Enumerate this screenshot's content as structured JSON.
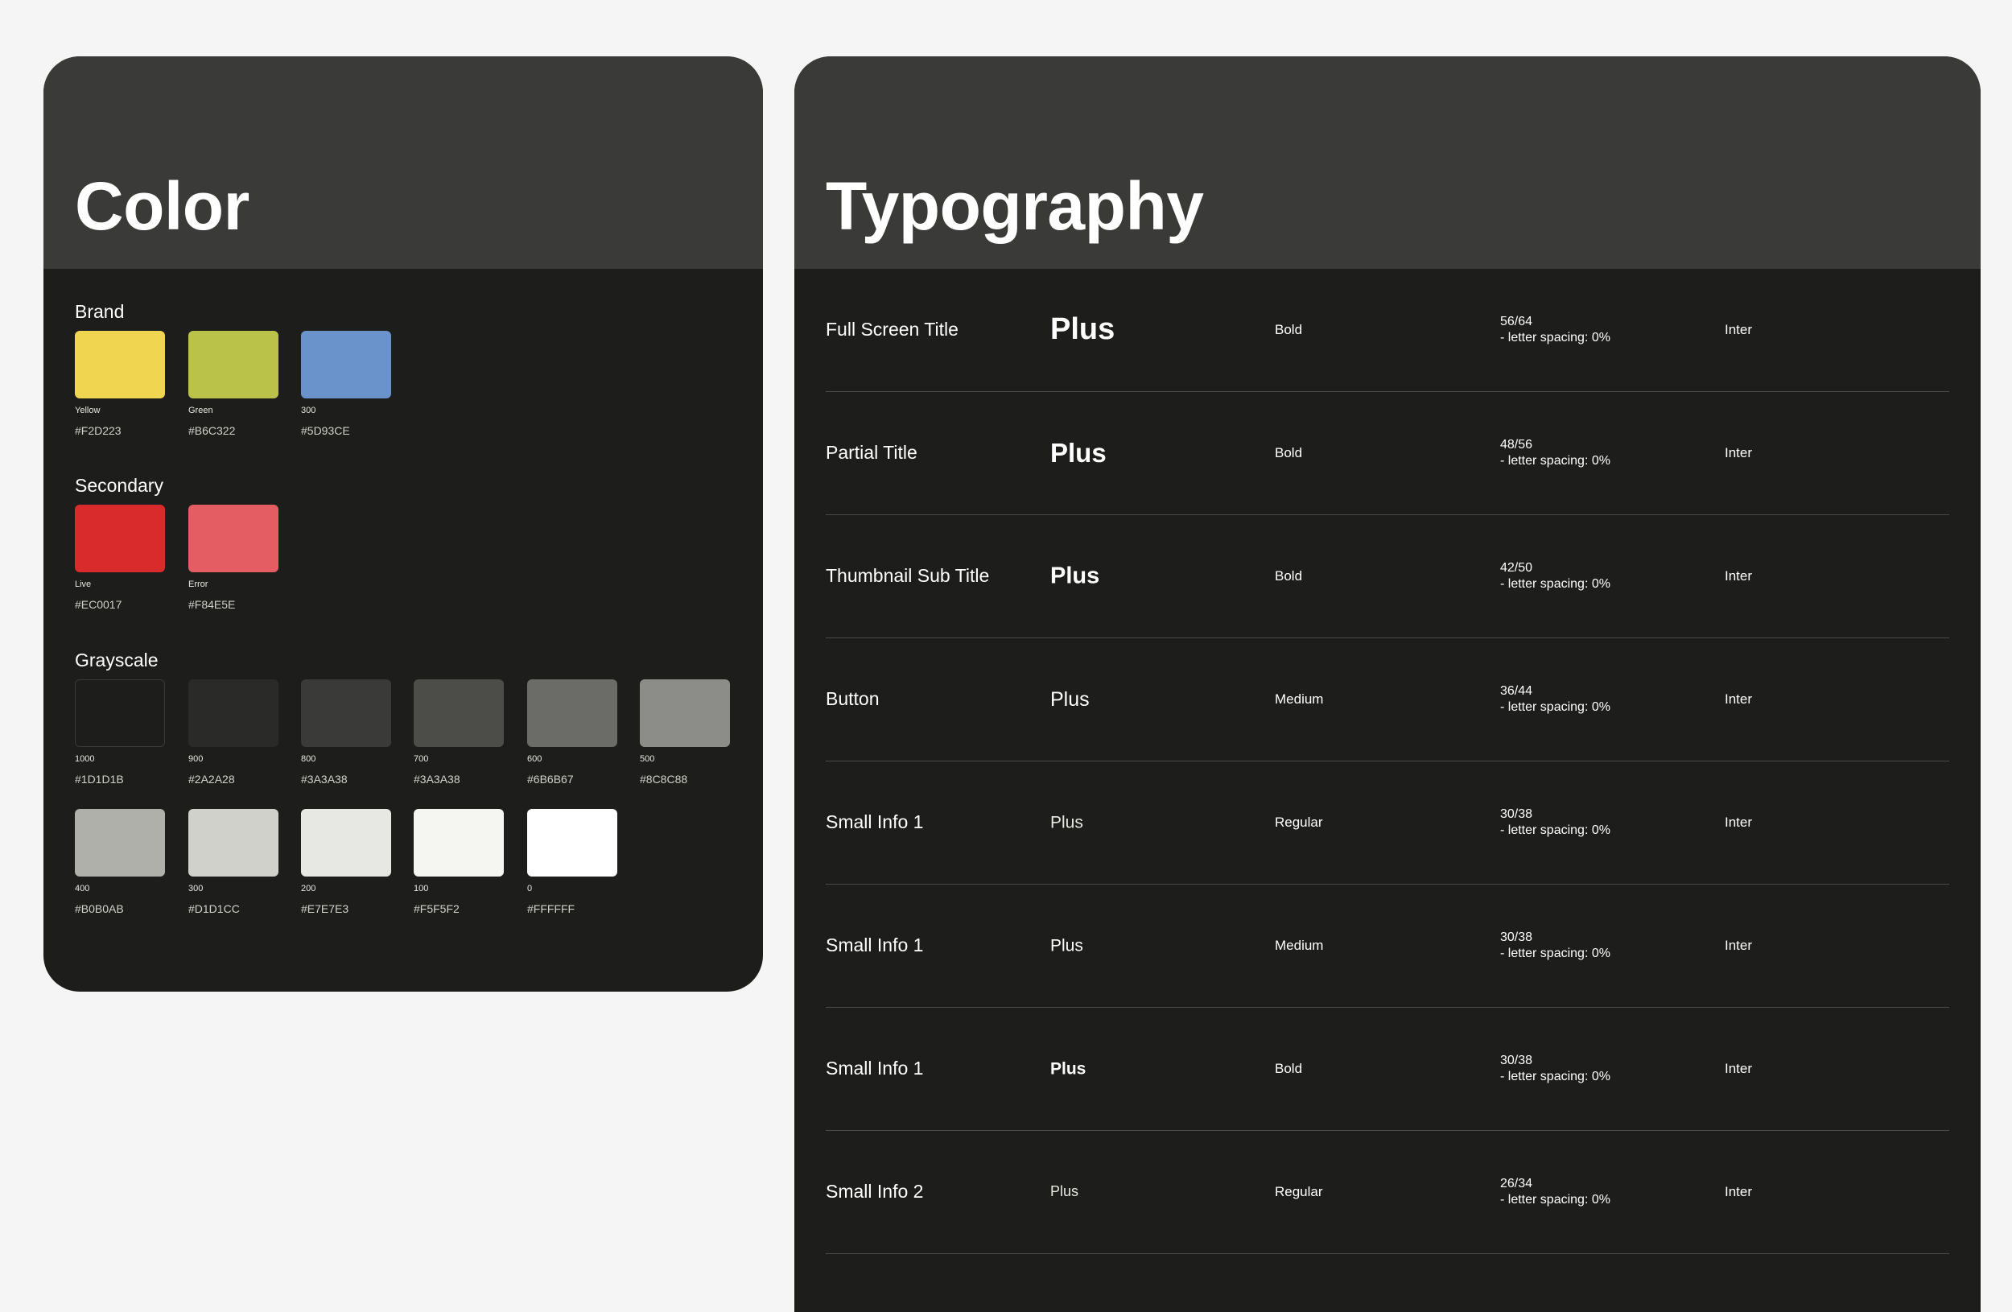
{
  "color_panel": {
    "title": "Color",
    "sections": [
      {
        "title": "Brand",
        "swatches": [
          {
            "label": "Yellow",
            "hex": "#F2D223",
            "color": "#f0d551"
          },
          {
            "label": "Green",
            "hex": "#B6C322",
            "color": "#bac24a"
          },
          {
            "label": "300",
            "hex": "#5D93CE",
            "color": "#6a93cc"
          }
        ]
      },
      {
        "title": "Secondary",
        "swatches": [
          {
            "label": "Live",
            "hex": "#EC0017",
            "color": "#d92b2b"
          },
          {
            "label": "Error",
            "hex": "#F84E5E",
            "color": "#e35d63"
          }
        ]
      },
      {
        "title": "Grayscale",
        "swatches": [
          {
            "label": "1000",
            "hex": "#1D1D1B",
            "color": "#1d1d1b",
            "outlined": true
          },
          {
            "label": "900",
            "hex": "#2A2A28",
            "color": "#2a2a28"
          },
          {
            "label": "800",
            "hex": "#3A3A38",
            "color": "#3a3a38"
          },
          {
            "label": "700",
            "hex": "#3A3A38",
            "color": "#4c4c48"
          },
          {
            "label": "600",
            "hex": "#6B6B67",
            "color": "#6b6b67"
          },
          {
            "label": "500",
            "hex": "#8C8C88",
            "color": "#8c8c88"
          },
          {
            "label": "400",
            "hex": "#B0B0AB",
            "color": "#b0b0ab"
          },
          {
            "label": "300",
            "hex": "#D1D1CC",
            "color": "#d1d1cc"
          },
          {
            "label": "200",
            "hex": "#E7E7E3",
            "color": "#e7e7e3"
          },
          {
            "label": "100",
            "hex": "#F5F5F2",
            "color": "#f5f5f2"
          },
          {
            "label": "0",
            "hex": "#FFFFFF",
            "color": "#ffffff"
          }
        ]
      }
    ]
  },
  "type_panel": {
    "title": "Typography",
    "rows": [
      {
        "name": "Full Screen Title",
        "sample": "Plus",
        "weight": "Bold",
        "size": "56/64",
        "spacing": "- letter spacing: 0%",
        "font": "Inter"
      },
      {
        "name": "Partial Title",
        "sample": "Plus",
        "weight": "Bold",
        "size": "48/56",
        "spacing": "- letter spacing: 0%",
        "font": "Inter"
      },
      {
        "name": "Thumbnail Sub Title",
        "sample": "Plus",
        "weight": "Bold",
        "size": "42/50",
        "spacing": "- letter spacing: 0%",
        "font": "Inter"
      },
      {
        "name": "Button",
        "sample": "Plus",
        "weight": "Medium",
        "size": "36/44",
        "spacing": "- letter spacing: 0%",
        "font": "Inter"
      },
      {
        "name": "Small Info 1",
        "sample": "Plus",
        "weight": "Regular",
        "size": "30/38",
        "spacing": "- letter spacing: 0%",
        "font": "Inter"
      },
      {
        "name": "Small Info 1",
        "sample": "Plus",
        "weight": "Medium",
        "size": "30/38",
        "spacing": "- letter spacing: 0%",
        "font": "Inter"
      },
      {
        "name": "Small Info 1",
        "sample": "Plus",
        "weight": "Bold",
        "size": "30/38",
        "spacing": "- letter spacing: 0%",
        "font": "Inter"
      },
      {
        "name": "Small Info 2",
        "sample": "Plus",
        "weight": "Regular",
        "size": "26/34",
        "spacing": "- letter spacing: 0%",
        "font": "Inter"
      }
    ]
  }
}
